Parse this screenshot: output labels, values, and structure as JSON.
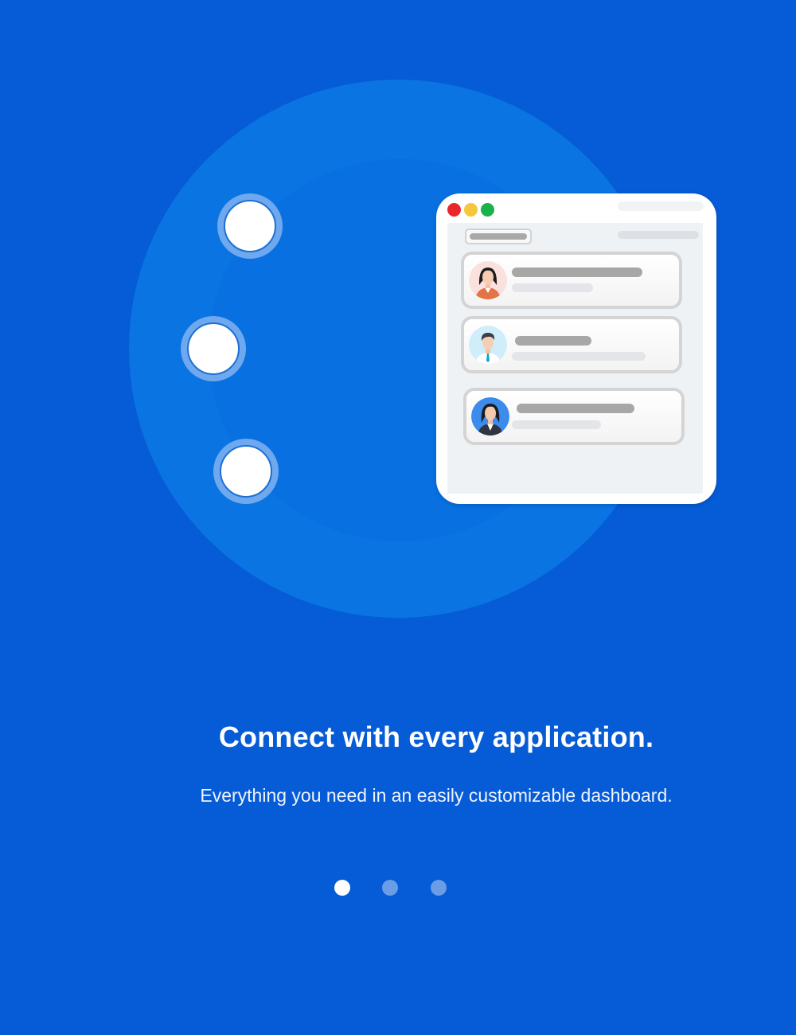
{
  "onboarding": {
    "headline": "Connect with every application.",
    "subtext": "Everything you need in an easily customizable dashboard."
  },
  "pagination": {
    "total_pages": 3,
    "current_page": 1
  },
  "illustration": {
    "app_window": {
      "traffic_lights": [
        "close-icon",
        "minimize-icon",
        "maximize-icon"
      ],
      "cards": [
        {
          "avatar": "woman-avatar-icon"
        },
        {
          "avatar": "man-avatar-icon"
        },
        {
          "avatar": "woman-suit-avatar-icon"
        }
      ]
    },
    "nodes": 3
  },
  "colors": {
    "background": "#065bd6",
    "circle": "#0a74e3",
    "dot_active": "#ffffff",
    "dot_inactive": "#6b9ce6"
  }
}
